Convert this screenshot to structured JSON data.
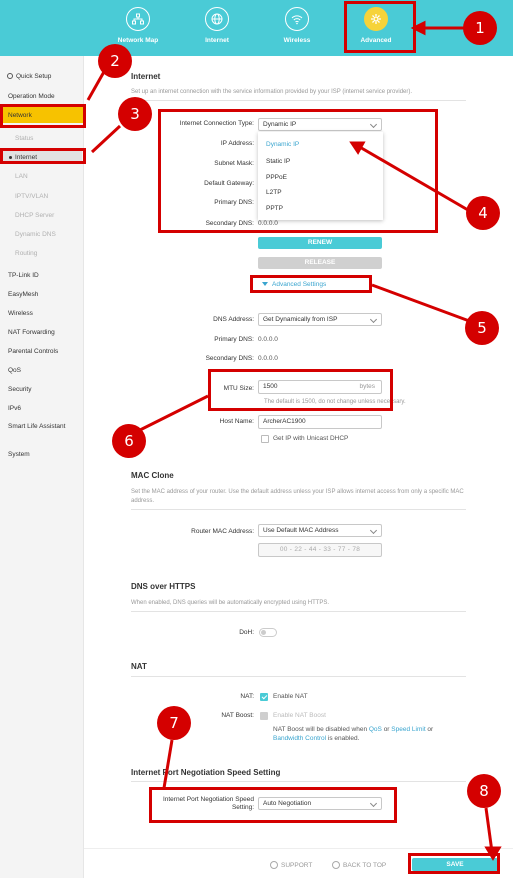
{
  "nav": {
    "items": [
      {
        "label": "Network Map",
        "icon": "network-map-icon"
      },
      {
        "label": "Internet",
        "icon": "globe-icon"
      },
      {
        "label": "Wireless",
        "icon": "wifi-icon"
      },
      {
        "label": "Advanced",
        "icon": "gear-icon"
      }
    ]
  },
  "sidebar": {
    "quick_setup": "Quick Setup",
    "operation_mode": "Operation Mode",
    "network": "Network",
    "sub": [
      "Status",
      "Internet",
      "LAN",
      "IPTV/VLAN",
      "DHCP Server",
      "Dynamic DNS",
      "Routing"
    ],
    "items": [
      "TP-Link ID",
      "EasyMesh",
      "Wireless",
      "NAT Forwarding",
      "Parental Controls",
      "QoS",
      "Security",
      "IPv6",
      "Smart Life Assistant",
      "System"
    ]
  },
  "internet": {
    "title": "Internet",
    "desc": "Set up an internet connection with the service information provided by your ISP (internet service provider).",
    "conn_type_label": "Internet Connection Type:",
    "conn_type_value": "Dynamic IP",
    "conn_options": [
      "Dynamic IP",
      "Static IP",
      "PPPoE",
      "L2TP",
      "PPTP"
    ],
    "ip_label": "IP Address:",
    "mask_label": "Subnet Mask:",
    "gateway_label": "Default Gateway:",
    "primary_dns_label": "Primary DNS:",
    "secondary_dns_label": "Secondary DNS:",
    "secondary_dns_value": "0.0.0.0",
    "renew": "RENEW",
    "release": "RELEASE",
    "advanced_settings": "Advanced Settings",
    "dns_address_label": "DNS Address:",
    "dns_address_value": "Get Dynamically from ISP",
    "adv_primary_dns_label": "Primary DNS:",
    "adv_primary_dns_value": "0.0.0.0",
    "adv_secondary_dns_label": "Secondary DNS:",
    "adv_secondary_dns_value": "0.0.0.0",
    "mtu_label": "MTU Size:",
    "mtu_value": "1500",
    "mtu_unit": "bytes",
    "mtu_hint": "The default is 1500, do not change unless necessary.",
    "host_label": "Host Name:",
    "host_value": "ArcherAC1900",
    "unicast_label": "Get IP with Unicast DHCP"
  },
  "mac": {
    "title": "MAC Clone",
    "desc": "Set the MAC address of your router. Use the default address unless your ISP allows internet access from only a specific MAC address.",
    "router_mac_label": "Router MAC Address:",
    "router_mac_value": "Use Default MAC Address",
    "mac_value": "00 - 22 - 44 - 33 - 77 - 78"
  },
  "doh": {
    "title": "DNS over HTTPS",
    "desc": "When enabled, DNS queries will be automatically encrypted using HTTPS.",
    "label": "DoH:"
  },
  "nat": {
    "title": "NAT",
    "nat_label": "NAT:",
    "enable_nat": "Enable NAT",
    "boost_label": "NAT Boost:",
    "enable_boost": "Enable NAT Boost",
    "note_pre": "NAT Boost will be disabled when ",
    "note_qos": "QoS",
    "note_or1": " or ",
    "note_speed": "Speed Limit",
    "note_or2": " or",
    "note_bw": "Bandwidth Control",
    "note_post": " is enabled."
  },
  "speed": {
    "title": "Internet Port Negotiation Speed Setting",
    "label_line1": "Internet Port Negotiation Speed",
    "label_line2": "Setting:",
    "value": "Auto Negotiation"
  },
  "footer": {
    "support": "SUPPORT",
    "back_to_top": "BACK TO TOP",
    "save": "SAVE"
  },
  "badges": [
    "1",
    "2",
    "3",
    "4",
    "5",
    "6",
    "7",
    "8"
  ],
  "colors": {
    "accent": "#4acbd6",
    "highlight": "#f7c200",
    "annotation": "#d40000"
  }
}
